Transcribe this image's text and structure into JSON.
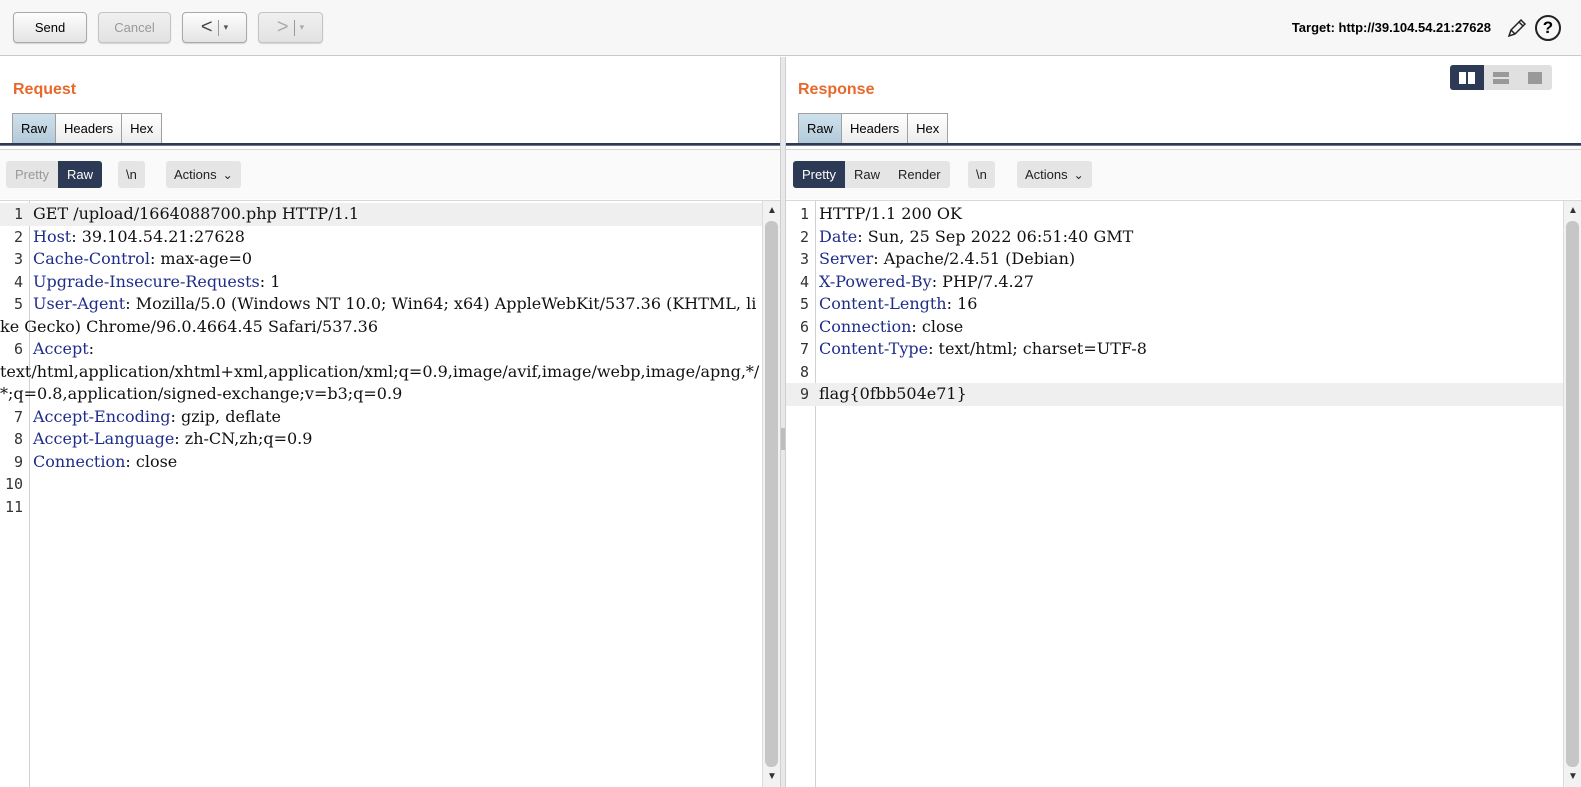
{
  "toolbar": {
    "send_label": "Send",
    "cancel_label": "Cancel",
    "back_glyph": "<",
    "forward_glyph": ">",
    "dropdown_glyph": "▾",
    "target_text": "Target: http://39.104.54.21:27628",
    "help_glyph": "?"
  },
  "request": {
    "title": "Request",
    "tabs": [
      "Raw",
      "Headers",
      "Hex"
    ],
    "active_tab": "Raw",
    "view_modes": [
      "Pretty",
      "Raw"
    ],
    "active_view": "Raw",
    "newline_label": "\\n",
    "actions_label": "Actions",
    "lines": [
      {
        "n": "1",
        "name": "",
        "rest": "GET /upload/1664088700.php HTTP/1.1"
      },
      {
        "n": "2",
        "name": "Host",
        "rest": ": 39.104.54.21:27628"
      },
      {
        "n": "3",
        "name": "Cache-Control",
        "rest": ": max-age=0"
      },
      {
        "n": "4",
        "name": "Upgrade-Insecure-Requests",
        "rest": ": 1"
      },
      {
        "n": "5",
        "name": "User-Agent",
        "rest": ": Mozilla/5.0 (Windows NT 10.0; Win64; x64) AppleWebKit/537.36 (KHTML, like Gecko) Chrome/96.0.4664.45 Safari/537.36"
      },
      {
        "n": "6",
        "name": "Accept",
        "rest": ":\ntext/html,application/xhtml+xml,application/xml;q=0.9,image/avif,image/webp,image/apng,*/*;q=0.8,application/signed-exchange;v=b3;q=0.9"
      },
      {
        "n": "7",
        "name": "Accept-Encoding",
        "rest": ": gzip, deflate"
      },
      {
        "n": "8",
        "name": "Accept-Language",
        "rest": ": zh-CN,zh;q=0.9"
      },
      {
        "n": "9",
        "name": "Connection",
        "rest": ": close"
      },
      {
        "n": "10",
        "name": "",
        "rest": ""
      },
      {
        "n": "11",
        "name": "",
        "rest": ""
      }
    ]
  },
  "response": {
    "title": "Response",
    "tabs": [
      "Raw",
      "Headers",
      "Hex"
    ],
    "active_tab": "Raw",
    "view_modes": [
      "Pretty",
      "Raw",
      "Render"
    ],
    "active_view": "Pretty",
    "newline_label": "\\n",
    "actions_label": "Actions",
    "lines": [
      {
        "n": "1",
        "name": "",
        "rest": "HTTP/1.1 200 OK"
      },
      {
        "n": "2",
        "name": "Date",
        "rest": ": Sun, 25 Sep 2022 06:51:40 GMT"
      },
      {
        "n": "3",
        "name": "Server",
        "rest": ": Apache/2.4.51 (Debian)"
      },
      {
        "n": "4",
        "name": "X-Powered-By",
        "rest": ": PHP/7.4.27"
      },
      {
        "n": "5",
        "name": "Content-Length",
        "rest": ": 16"
      },
      {
        "n": "6",
        "name": "Connection",
        "rest": ": close"
      },
      {
        "n": "7",
        "name": "Content-Type",
        "rest": ": text/html; charset=UTF-8"
      },
      {
        "n": "8",
        "name": "",
        "rest": ""
      },
      {
        "n": "9",
        "name": "",
        "rest": "flag{0fbb504e71}"
      }
    ]
  },
  "colors": {
    "accent_title": "#e8692c",
    "active_segment": "#2d3a55",
    "header_name": "#1f2d8a"
  },
  "icons": {
    "edit": "pencil-icon",
    "help": "help-icon",
    "layout_side_by_side": "layout-columns-icon",
    "layout_stacked": "layout-rows-icon",
    "layout_single": "layout-single-icon"
  }
}
